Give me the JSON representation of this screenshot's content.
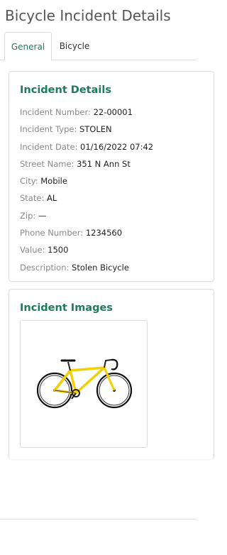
{
  "page": {
    "title": "Bicycle Incident Details"
  },
  "tabs": [
    {
      "label": "General",
      "active": true
    },
    {
      "label": "Bicycle",
      "active": false
    }
  ],
  "details": {
    "title": "Incident Details",
    "fields": [
      {
        "label": "Incident Number:",
        "value": "22-00001"
      },
      {
        "label": "Incident Type:",
        "value": "STOLEN"
      },
      {
        "label": "Incident Date:",
        "value": "01/16/2022 07:42"
      },
      {
        "label": "Street Name:",
        "value": "351 N Ann St"
      },
      {
        "label": "City:",
        "value": "Mobile"
      },
      {
        "label": "State:",
        "value": "AL"
      },
      {
        "label": "Zip:",
        "value": "—"
      },
      {
        "label": "Phone Number:",
        "value": "1234560"
      },
      {
        "label": "Value:",
        "value": "1500"
      },
      {
        "label": "Description:",
        "value": "Stolen Bicycle"
      }
    ]
  },
  "images": {
    "title": "Incident Images",
    "items": [
      {
        "icon": "bicycle-image",
        "frame_color": "#f5d000"
      }
    ]
  },
  "colors": {
    "accent": "#1e7b57",
    "label": "#888888",
    "border": "#dddddd"
  }
}
